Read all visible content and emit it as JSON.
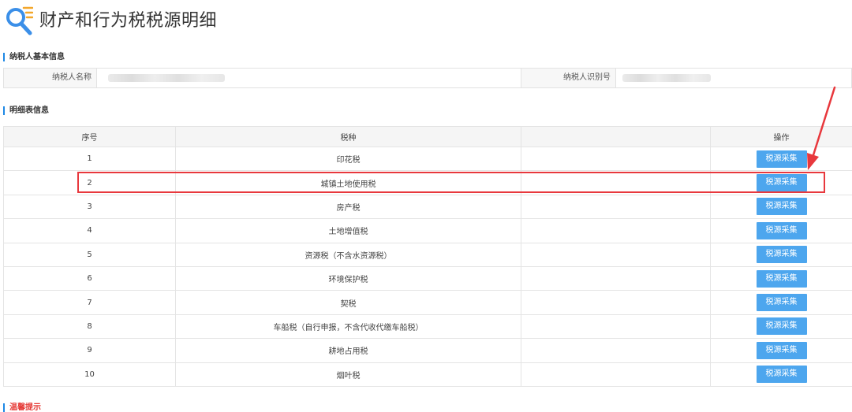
{
  "page": {
    "title": "财产和行为税税源明细"
  },
  "basic_info": {
    "section_title": "纳税人基本信息",
    "name_label": "纳税人名称",
    "id_label": "纳税人识别号"
  },
  "detail": {
    "section_title": "明细表信息",
    "columns": [
      "序号",
      "税种",
      "",
      "操作"
    ],
    "button_label": "税源采集",
    "rows": [
      {
        "no": "1",
        "tax": "印花税"
      },
      {
        "no": "2",
        "tax": "城镇土地使用税"
      },
      {
        "no": "3",
        "tax": "房产税"
      },
      {
        "no": "4",
        "tax": "土地增值税"
      },
      {
        "no": "5",
        "tax": "资源税（不含水资源税）"
      },
      {
        "no": "6",
        "tax": "环境保护税"
      },
      {
        "no": "7",
        "tax": "契税"
      },
      {
        "no": "8",
        "tax": "车船税（自行申报，不含代收代缴车船税）"
      },
      {
        "no": "9",
        "tax": "耕地占用税"
      },
      {
        "no": "10",
        "tax": "烟叶税"
      }
    ]
  },
  "tips": {
    "section_title": "温馨提示"
  },
  "colors": {
    "accent": "#4da6ee",
    "highlight": "#e8383d",
    "section_bar": "#1e88e5"
  }
}
